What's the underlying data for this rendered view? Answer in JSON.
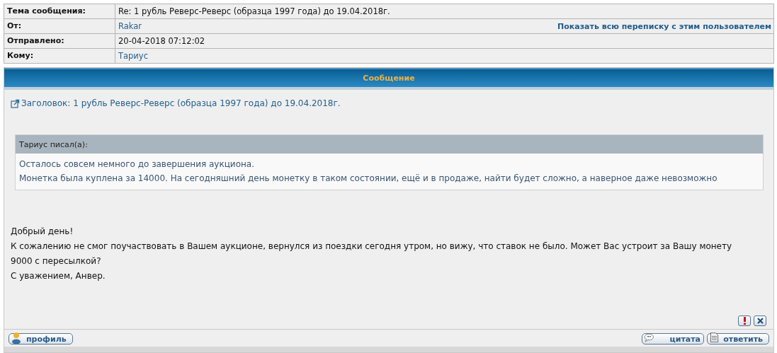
{
  "header_fields": [
    {
      "label": "Тема сообщения:",
      "value": "Re: 1 рубль Реверс-Реверс (образца 1997 года) до 19.04.2018г.",
      "kind": "text"
    },
    {
      "label": "От:",
      "value": "Rakar",
      "kind": "link",
      "action": "Показать всю переписку с этим пользователем"
    },
    {
      "label": "Отправлено:",
      "value": "20-04-2018 07:12:02",
      "kind": "text"
    },
    {
      "label": "Кому:",
      "value": "Тариус",
      "kind": "link"
    }
  ],
  "panel_title": "Сообщение",
  "topic_link": "Заголовок: 1 рубль Реверс-Реверс (образца 1997 года) до 19.04.2018г.",
  "quote": {
    "author": "Тариус писал(а):",
    "lines": [
      "Осталось совсем немного до завершения аукциона.",
      "Монетка была куплена за 14000. На сегодняшний день монетку в таком состоянии, ещё и в продаже, найти будет сложно, а наверное даже невозможно"
    ]
  },
  "message_lines": [
    "Добрый день!",
    "К сожалению не смог поучаствовать в Вашем аукционе, вернулся из поездки сегодня утром, но вижу, что ставок не было. Может Вас устроит за Вашу монету 9000 с пересылкой?",
    "С уважением, Анвер."
  ],
  "footer_buttons": [
    {
      "label": "профиль",
      "kind": "profile"
    },
    {
      "label": "цитата",
      "kind": "quote"
    },
    {
      "label": "ответить",
      "kind": "reply"
    }
  ]
}
